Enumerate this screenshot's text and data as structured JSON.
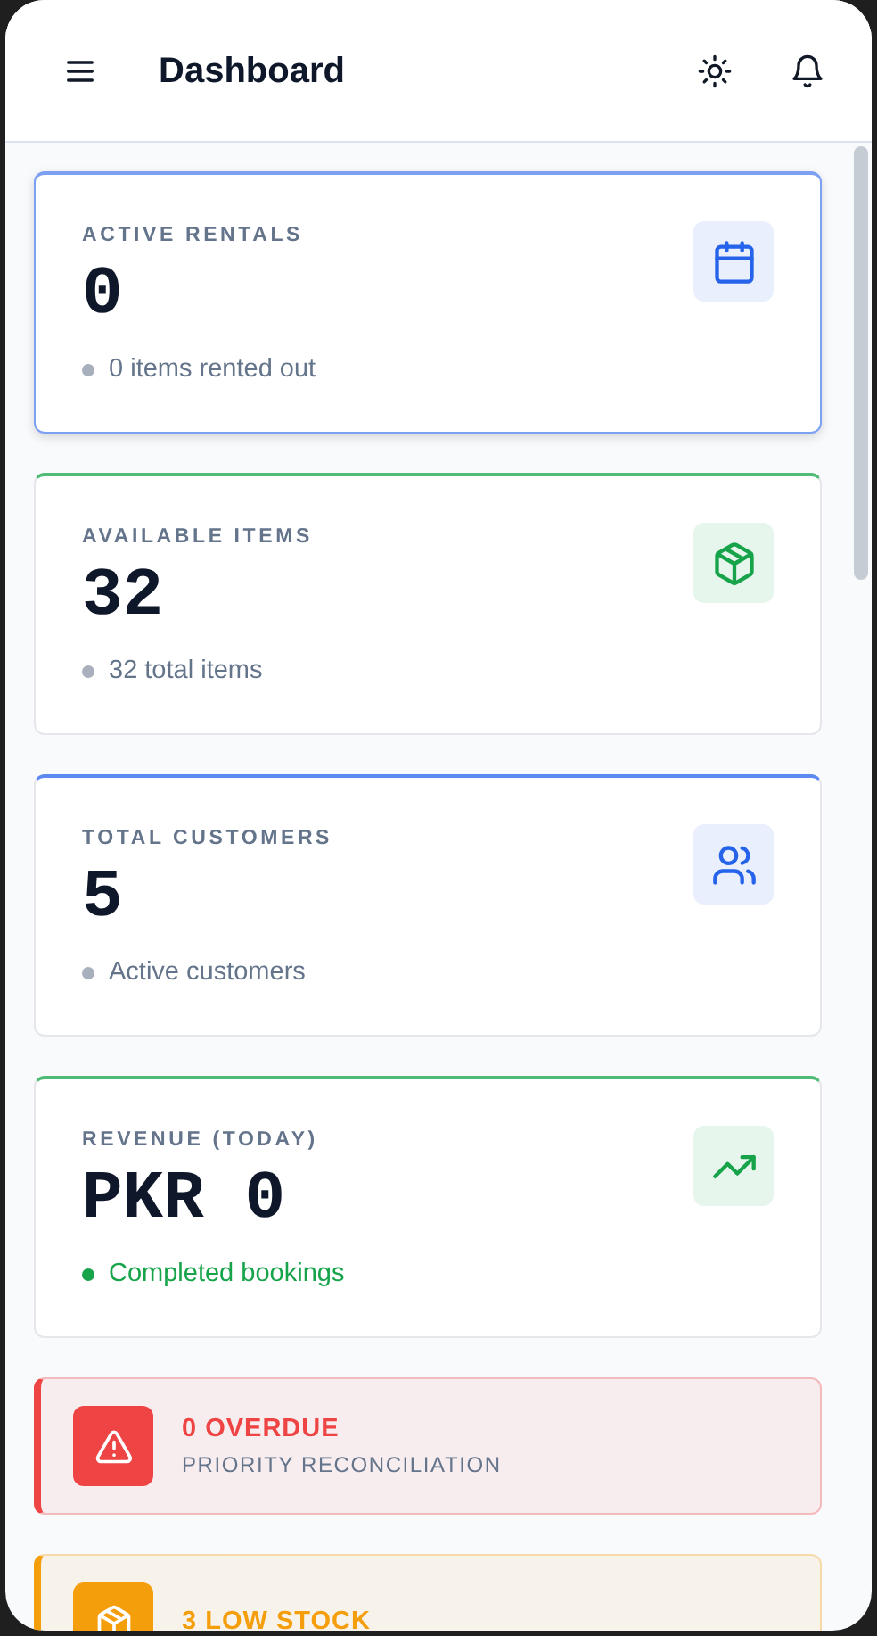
{
  "header": {
    "title": "Dashboard"
  },
  "stats": [
    {
      "label": "ACTIVE RENTALS",
      "value": "0",
      "note": "0 items rented out",
      "kind": "rentals",
      "color": "#2563eb",
      "selected": true
    },
    {
      "label": "AVAILABLE ITEMS",
      "value": "32",
      "note": "32 total items",
      "kind": "items",
      "color": "#16a34a",
      "selected": false
    },
    {
      "label": "TOTAL CUSTOMERS",
      "value": "5",
      "note": "Active customers",
      "kind": "customers",
      "color": "#2563eb",
      "selected": false
    },
    {
      "label": "REVENUE (TODAY)",
      "value": "PKR 0",
      "note": "Completed bookings",
      "kind": "revenue",
      "color": "#16a34a",
      "selected": false
    }
  ],
  "alerts": [
    {
      "kind": "overdue",
      "title": "0 OVERDUE",
      "subtitle": "PRIORITY RECONCILIATION",
      "color": "#ef4444"
    },
    {
      "kind": "stock",
      "title": "3 LOW STOCK",
      "color": "#f59e0b"
    }
  ]
}
